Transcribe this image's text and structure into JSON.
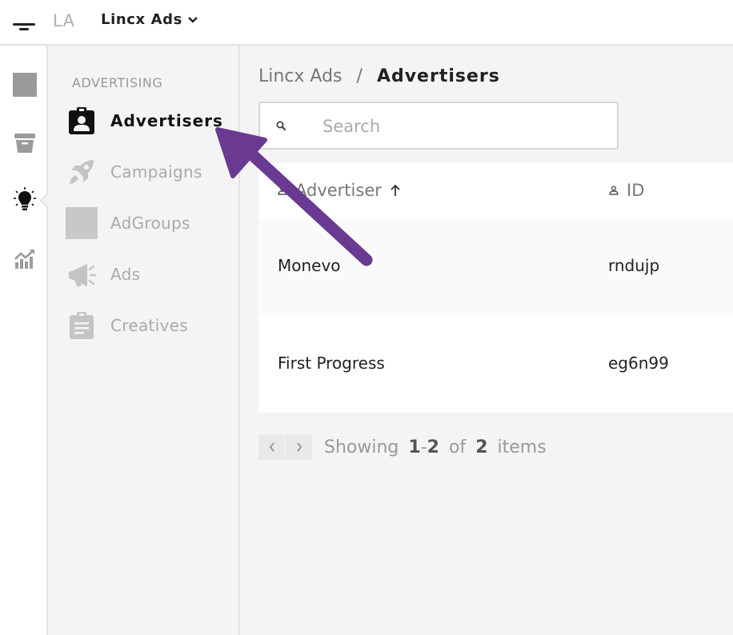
{
  "topbar": {
    "org_initials": "LA",
    "org_name": "Lincx Ads",
    "menu_icon": "hamburger-icon",
    "org_chevron_icon": "chevron-down-icon"
  },
  "rail": {
    "items": [
      {
        "icon": "placeholder-square-icon"
      },
      {
        "icon": "archive-icon"
      },
      {
        "icon": "lightbulb-icon",
        "active": true
      },
      {
        "icon": "analytics-icon"
      }
    ]
  },
  "sidebar": {
    "section_label": "ADVERTISING",
    "items": [
      {
        "label": "Advertisers",
        "icon": "badge-icon",
        "active": true
      },
      {
        "label": "Campaigns",
        "icon": "rocket-icon"
      },
      {
        "label": "AdGroups",
        "icon": "placeholder-square-icon"
      },
      {
        "label": "Ads",
        "icon": "megaphone-icon"
      },
      {
        "label": "Creatives",
        "icon": "clipboard-icon"
      }
    ]
  },
  "main": {
    "breadcrumb": {
      "root": "Lincx Ads",
      "separator": "/",
      "current": "Advertisers"
    },
    "search": {
      "placeholder": "Search",
      "value": ""
    },
    "table": {
      "columns": [
        {
          "label": "Advertiser",
          "icon": "person-icon",
          "sort": "ascending"
        },
        {
          "label": "ID",
          "icon": "person-icon"
        }
      ],
      "rows": [
        {
          "name": "Monevo",
          "id": "rndujp"
        },
        {
          "name": "First Progress",
          "id": "eg6n99"
        }
      ]
    },
    "pagination": {
      "showing_label": "Showing",
      "range_start": "1",
      "range_dash": "-",
      "range_end": "2",
      "of_label": "of",
      "total": "2",
      "items_label": "items"
    }
  },
  "colors": {
    "annotation_arrow": "#6a3a93",
    "sidebar_bg": "#f4f4f4",
    "text_muted": "#aaaaaa"
  }
}
